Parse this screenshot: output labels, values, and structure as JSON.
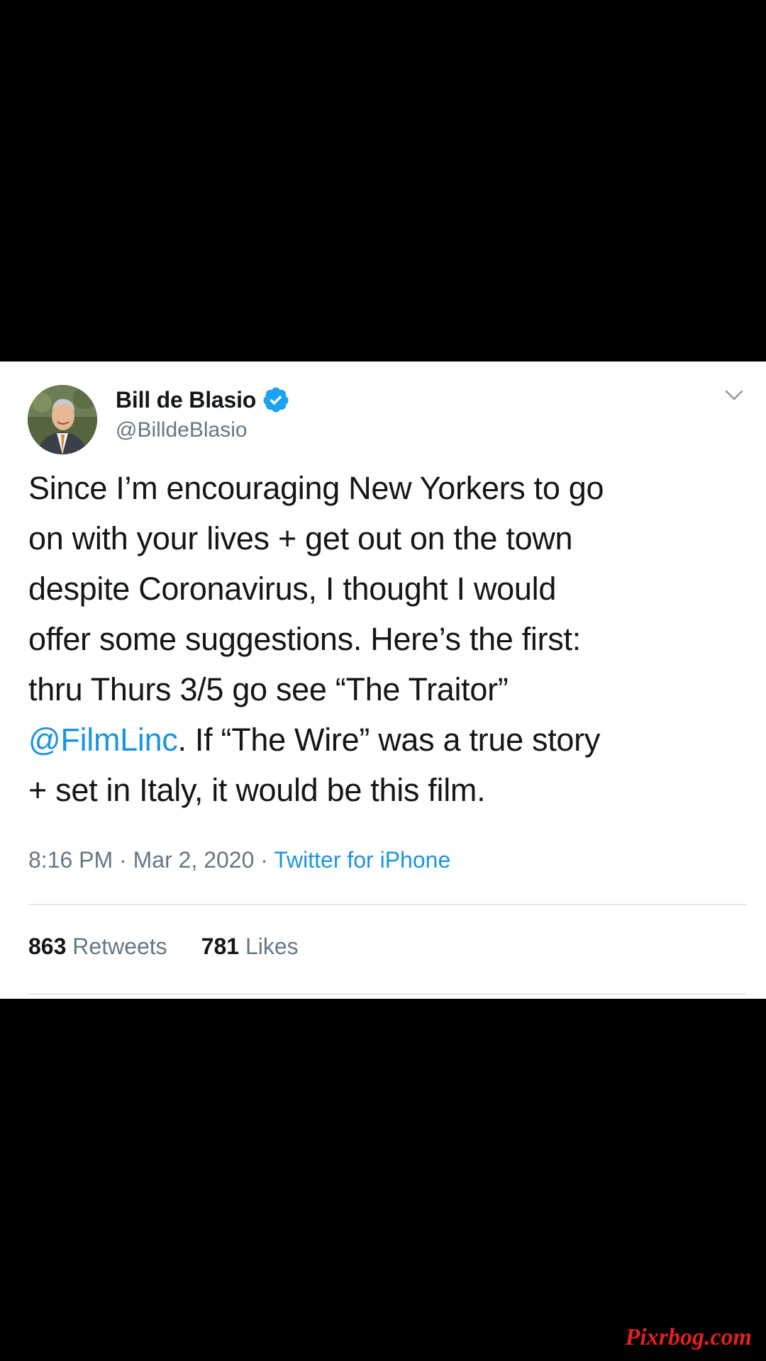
{
  "tweet": {
    "author": {
      "name": "Bill de Blasio",
      "handle": "@BilldeBlasio",
      "verified": true
    },
    "text_lines": [
      "Since I’m encouraging New Yorkers to go",
      "on with your lives + get out on the town",
      "despite Coronavirus, I thought I would",
      "offer some suggestions. Here’s the first:",
      "thru Thurs 3/5 go see “The Traitor”"
    ],
    "mention": "@FilmLinc",
    "line6_rest": ". If “The Wire” was a true story",
    "line7": "+ set in Italy, it would be this film.",
    "time": "8:16 PM",
    "separator": "·",
    "date": "Mar 2, 2020",
    "source": "Twitter for iPhone",
    "retweets_count": "863",
    "retweets_label": "Retweets",
    "likes_count": "781",
    "likes_label": "Likes"
  },
  "watermark": "Pixrbog.com",
  "colors": {
    "background": "#000000",
    "card": "#ffffff",
    "text_primary": "#14171a",
    "text_secondary": "#657786",
    "link": "#1b95e0",
    "verified": "#1da1f2",
    "watermark": "#e02020"
  },
  "icons": {
    "verified": "verified-badge-icon",
    "menu": "chevron-down-icon"
  }
}
